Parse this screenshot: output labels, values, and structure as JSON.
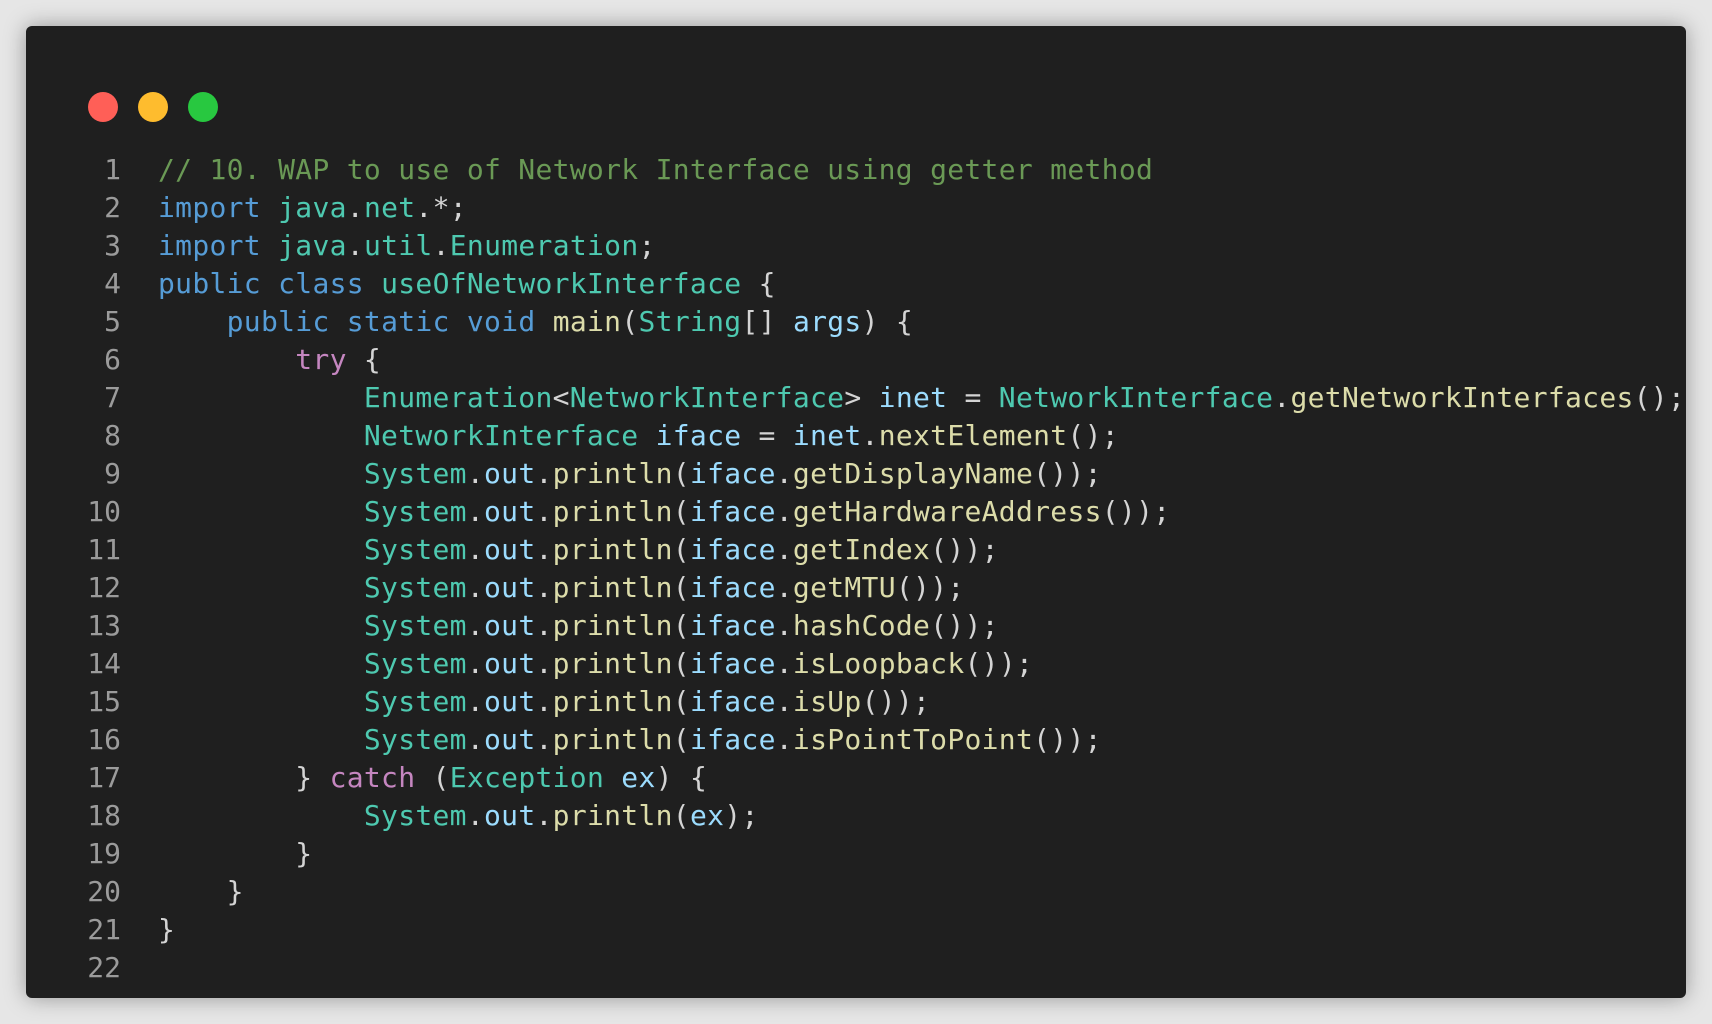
{
  "window": {
    "controls": [
      {
        "name": "close-dot",
        "color": "#ff5f57"
      },
      {
        "name": "minimize-dot",
        "color": "#febc2e"
      },
      {
        "name": "maximize-dot",
        "color": "#28c840"
      }
    ]
  },
  "editor": {
    "language": "java",
    "lines": [
      {
        "n": "1",
        "tokens": [
          [
            "comment",
            "// 10. WAP to use of Network Interface using getter method"
          ]
        ]
      },
      {
        "n": "2",
        "tokens": [
          [
            "keyword",
            "import"
          ],
          [
            "plain",
            " "
          ],
          [
            "type",
            "java"
          ],
          [
            "plain",
            "."
          ],
          [
            "type",
            "net"
          ],
          [
            "plain",
            ".*;"
          ]
        ]
      },
      {
        "n": "3",
        "tokens": [
          [
            "keyword",
            "import"
          ],
          [
            "plain",
            " "
          ],
          [
            "type",
            "java"
          ],
          [
            "plain",
            "."
          ],
          [
            "type",
            "util"
          ],
          [
            "plain",
            "."
          ],
          [
            "type",
            "Enumeration"
          ],
          [
            "plain",
            ";"
          ]
        ]
      },
      {
        "n": "4",
        "tokens": [
          [
            "keyword",
            "public"
          ],
          [
            "plain",
            " "
          ],
          [
            "keyword",
            "class"
          ],
          [
            "plain",
            " "
          ],
          [
            "type",
            "useOfNetworkInterface"
          ],
          [
            "plain",
            " {"
          ]
        ]
      },
      {
        "n": "5",
        "tokens": [
          [
            "plain",
            "    "
          ],
          [
            "keyword",
            "public"
          ],
          [
            "plain",
            " "
          ],
          [
            "keyword",
            "static"
          ],
          [
            "plain",
            " "
          ],
          [
            "keyword",
            "void"
          ],
          [
            "plain",
            " "
          ],
          [
            "function",
            "main"
          ],
          [
            "plain",
            "("
          ],
          [
            "type",
            "String"
          ],
          [
            "plain",
            "[] "
          ],
          [
            "variable",
            "args"
          ],
          [
            "plain",
            ") {"
          ]
        ]
      },
      {
        "n": "6",
        "tokens": [
          [
            "plain",
            "        "
          ],
          [
            "control",
            "try"
          ],
          [
            "plain",
            " {"
          ]
        ]
      },
      {
        "n": "7",
        "tokens": [
          [
            "plain",
            "            "
          ],
          [
            "type",
            "Enumeration"
          ],
          [
            "plain",
            "<"
          ],
          [
            "type",
            "NetworkInterface"
          ],
          [
            "plain",
            "> "
          ],
          [
            "variable",
            "inet"
          ],
          [
            "plain",
            " = "
          ],
          [
            "type",
            "NetworkInterface"
          ],
          [
            "plain",
            "."
          ],
          [
            "function",
            "getNetworkInterfaces"
          ],
          [
            "plain",
            "();"
          ]
        ]
      },
      {
        "n": "8",
        "tokens": [
          [
            "plain",
            "            "
          ],
          [
            "type",
            "NetworkInterface"
          ],
          [
            "plain",
            " "
          ],
          [
            "variable",
            "iface"
          ],
          [
            "plain",
            " = "
          ],
          [
            "variable",
            "inet"
          ],
          [
            "plain",
            "."
          ],
          [
            "function",
            "nextElement"
          ],
          [
            "plain",
            "();"
          ]
        ]
      },
      {
        "n": "9",
        "tokens": [
          [
            "plain",
            "            "
          ],
          [
            "type",
            "System"
          ],
          [
            "plain",
            "."
          ],
          [
            "variable",
            "out"
          ],
          [
            "plain",
            "."
          ],
          [
            "function",
            "println"
          ],
          [
            "plain",
            "("
          ],
          [
            "variable",
            "iface"
          ],
          [
            "plain",
            "."
          ],
          [
            "function",
            "getDisplayName"
          ],
          [
            "plain",
            "());"
          ]
        ]
      },
      {
        "n": "10",
        "tokens": [
          [
            "plain",
            "            "
          ],
          [
            "type",
            "System"
          ],
          [
            "plain",
            "."
          ],
          [
            "variable",
            "out"
          ],
          [
            "plain",
            "."
          ],
          [
            "function",
            "println"
          ],
          [
            "plain",
            "("
          ],
          [
            "variable",
            "iface"
          ],
          [
            "plain",
            "."
          ],
          [
            "function",
            "getHardwareAddress"
          ],
          [
            "plain",
            "());"
          ]
        ]
      },
      {
        "n": "11",
        "tokens": [
          [
            "plain",
            "            "
          ],
          [
            "type",
            "System"
          ],
          [
            "plain",
            "."
          ],
          [
            "variable",
            "out"
          ],
          [
            "plain",
            "."
          ],
          [
            "function",
            "println"
          ],
          [
            "plain",
            "("
          ],
          [
            "variable",
            "iface"
          ],
          [
            "plain",
            "."
          ],
          [
            "function",
            "getIndex"
          ],
          [
            "plain",
            "());"
          ]
        ]
      },
      {
        "n": "12",
        "tokens": [
          [
            "plain",
            "            "
          ],
          [
            "type",
            "System"
          ],
          [
            "plain",
            "."
          ],
          [
            "variable",
            "out"
          ],
          [
            "plain",
            "."
          ],
          [
            "function",
            "println"
          ],
          [
            "plain",
            "("
          ],
          [
            "variable",
            "iface"
          ],
          [
            "plain",
            "."
          ],
          [
            "function",
            "getMTU"
          ],
          [
            "plain",
            "());"
          ]
        ]
      },
      {
        "n": "13",
        "tokens": [
          [
            "plain",
            "            "
          ],
          [
            "type",
            "System"
          ],
          [
            "plain",
            "."
          ],
          [
            "variable",
            "out"
          ],
          [
            "plain",
            "."
          ],
          [
            "function",
            "println"
          ],
          [
            "plain",
            "("
          ],
          [
            "variable",
            "iface"
          ],
          [
            "plain",
            "."
          ],
          [
            "function",
            "hashCode"
          ],
          [
            "plain",
            "());"
          ]
        ]
      },
      {
        "n": "14",
        "tokens": [
          [
            "plain",
            "            "
          ],
          [
            "type",
            "System"
          ],
          [
            "plain",
            "."
          ],
          [
            "variable",
            "out"
          ],
          [
            "plain",
            "."
          ],
          [
            "function",
            "println"
          ],
          [
            "plain",
            "("
          ],
          [
            "variable",
            "iface"
          ],
          [
            "plain",
            "."
          ],
          [
            "function",
            "isLoopback"
          ],
          [
            "plain",
            "());"
          ]
        ]
      },
      {
        "n": "15",
        "tokens": [
          [
            "plain",
            "            "
          ],
          [
            "type",
            "System"
          ],
          [
            "plain",
            "."
          ],
          [
            "variable",
            "out"
          ],
          [
            "plain",
            "."
          ],
          [
            "function",
            "println"
          ],
          [
            "plain",
            "("
          ],
          [
            "variable",
            "iface"
          ],
          [
            "plain",
            "."
          ],
          [
            "function",
            "isUp"
          ],
          [
            "plain",
            "());"
          ]
        ]
      },
      {
        "n": "16",
        "tokens": [
          [
            "plain",
            "            "
          ],
          [
            "type",
            "System"
          ],
          [
            "plain",
            "."
          ],
          [
            "variable",
            "out"
          ],
          [
            "plain",
            "."
          ],
          [
            "function",
            "println"
          ],
          [
            "plain",
            "("
          ],
          [
            "variable",
            "iface"
          ],
          [
            "plain",
            "."
          ],
          [
            "function",
            "isPointToPoint"
          ],
          [
            "plain",
            "());"
          ]
        ]
      },
      {
        "n": "17",
        "tokens": [
          [
            "plain",
            "        } "
          ],
          [
            "control",
            "catch"
          ],
          [
            "plain",
            " ("
          ],
          [
            "type",
            "Exception"
          ],
          [
            "plain",
            " "
          ],
          [
            "variable",
            "ex"
          ],
          [
            "plain",
            ") {"
          ]
        ]
      },
      {
        "n": "18",
        "tokens": [
          [
            "plain",
            "            "
          ],
          [
            "type",
            "System"
          ],
          [
            "plain",
            "."
          ],
          [
            "variable",
            "out"
          ],
          [
            "plain",
            "."
          ],
          [
            "function",
            "println"
          ],
          [
            "plain",
            "("
          ],
          [
            "variable",
            "ex"
          ],
          [
            "plain",
            ");"
          ]
        ]
      },
      {
        "n": "19",
        "tokens": [
          [
            "plain",
            "        }"
          ]
        ]
      },
      {
        "n": "20",
        "tokens": [
          [
            "plain",
            "    }"
          ]
        ]
      },
      {
        "n": "21",
        "tokens": [
          [
            "plain",
            "}"
          ]
        ]
      },
      {
        "n": "22",
        "tokens": []
      }
    ]
  }
}
